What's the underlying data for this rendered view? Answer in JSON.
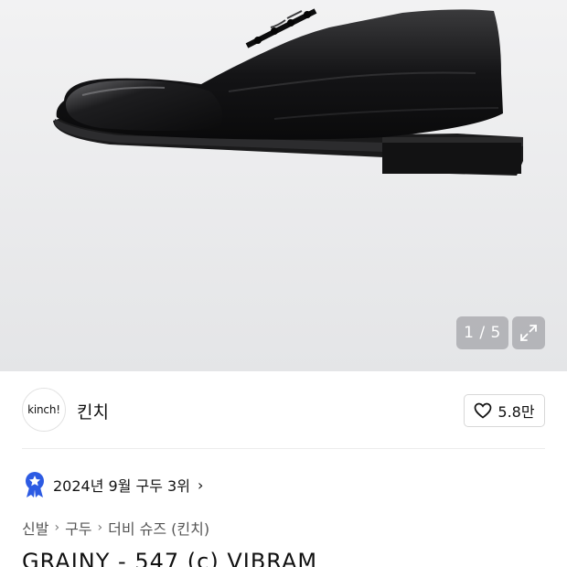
{
  "gallery": {
    "counter": "1 / 5",
    "image_alt": "black-leather-derby-shoe"
  },
  "brand": {
    "logo_text": "kinch!",
    "name": "킨치",
    "likes": "5.8만"
  },
  "ranking": {
    "text": "2024년 9월 구두 3위",
    "chevron": "›"
  },
  "breadcrumb": {
    "items": [
      "신발",
      "구두",
      "더비 슈즈 (킨치)"
    ],
    "separator": "›"
  },
  "product": {
    "title": "GRAINY - 547 (c) VIBRAM"
  },
  "colors": {
    "rank_badge": "#2d5be3"
  }
}
